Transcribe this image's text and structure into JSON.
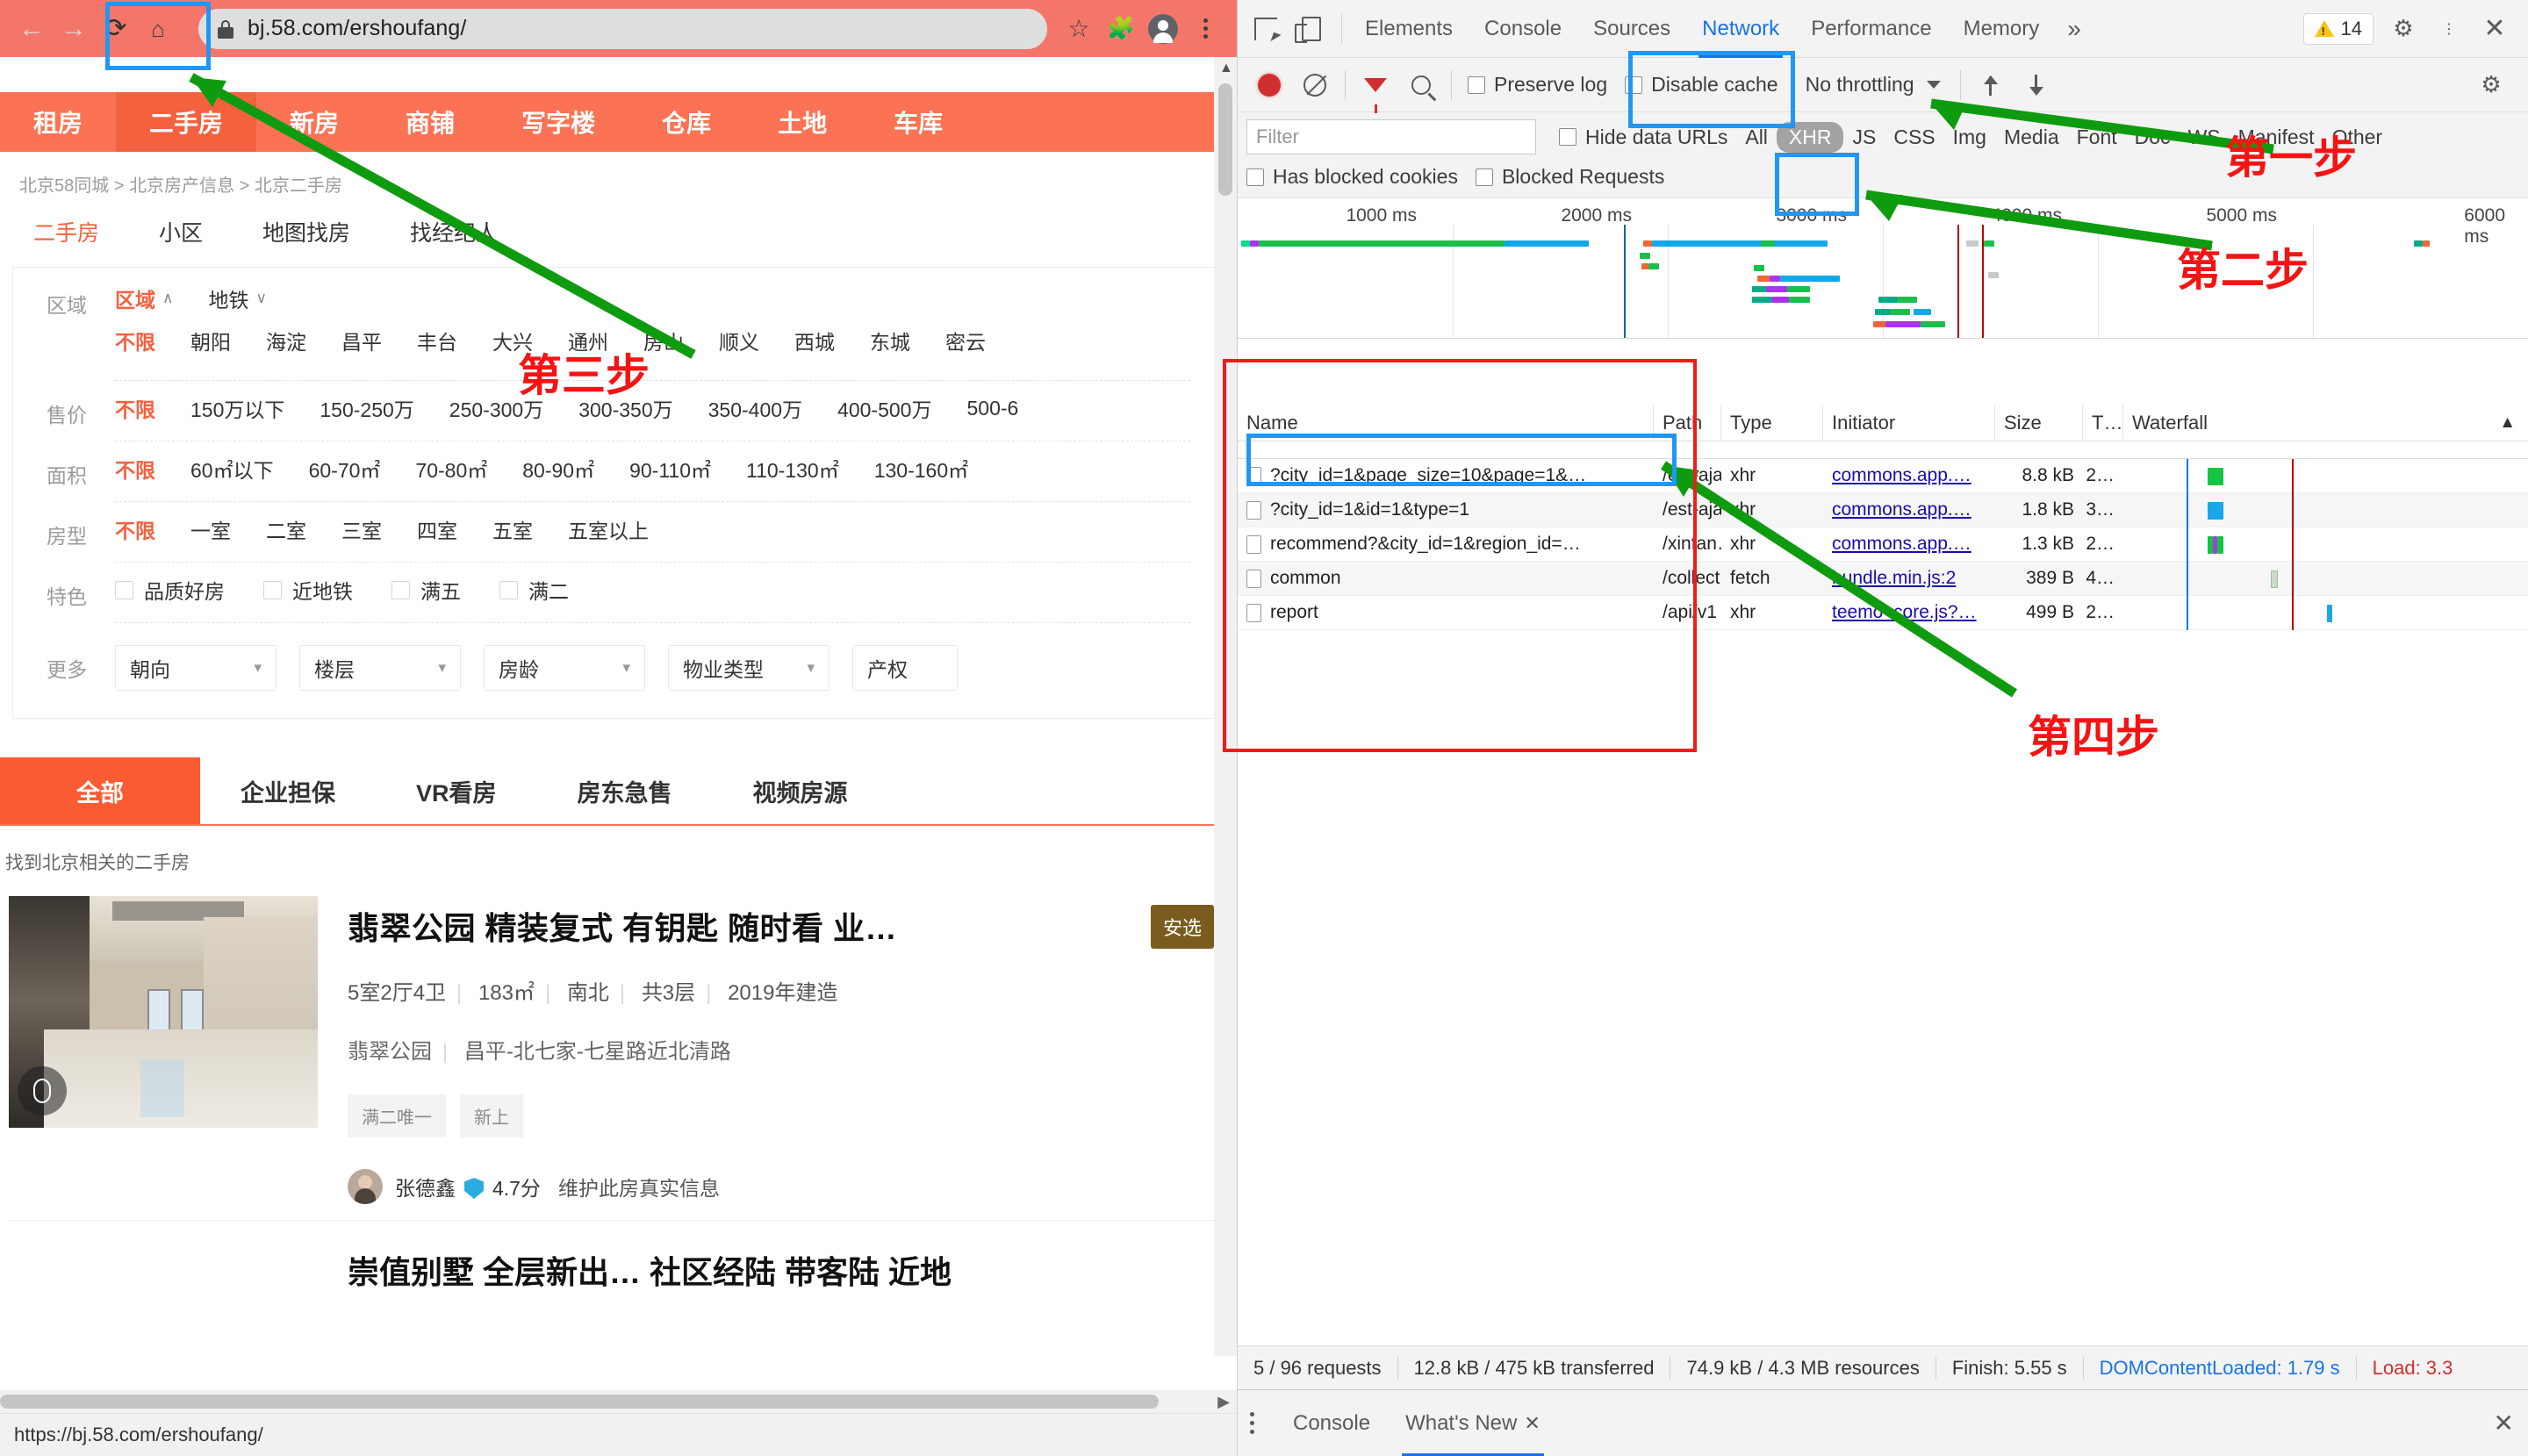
{
  "browser": {
    "url": "bj.58.com/ershoufang/",
    "status_url": "https://bj.58.com/ershoufang/",
    "icons": {
      "back": "←",
      "forward": "→",
      "reload": "⟳",
      "home": "⌂",
      "star": "☆",
      "puzzle": "🧩",
      "lock": "lock-icon"
    }
  },
  "site": {
    "nav": [
      {
        "label": "租房",
        "active": false
      },
      {
        "label": "二手房",
        "active": true
      },
      {
        "label": "新房",
        "active": false
      },
      {
        "label": "商铺",
        "active": false
      },
      {
        "label": "写字楼",
        "active": false
      },
      {
        "label": "仓库",
        "active": false
      },
      {
        "label": "土地",
        "active": false
      },
      {
        "label": "车库",
        "active": false
      }
    ],
    "breadcrumb": "北京58同城 > 北京房产信息 > 北京二手房",
    "subnav": [
      {
        "label": "二手房",
        "active": true
      },
      {
        "label": "小区",
        "active": false
      },
      {
        "label": "地图找房",
        "active": false
      },
      {
        "label": "找经纪人",
        "active": false
      }
    ],
    "filters": {
      "region": {
        "label": "区域",
        "toggles": [
          {
            "label": "区域",
            "selected": true,
            "caret": "∧"
          },
          {
            "label": "地铁",
            "selected": false,
            "caret": "∨"
          }
        ],
        "values": [
          "不限",
          "朝阳",
          "海淀",
          "昌平",
          "丰台",
          "大兴",
          "通州",
          "房山",
          "顺义",
          "西城",
          "东城",
          "密云"
        ],
        "selected": "不限"
      },
      "price": {
        "label": "售价",
        "values": [
          "不限",
          "150万以下",
          "150-250万",
          "250-300万",
          "300-350万",
          "350-400万",
          "400-500万",
          "500-6"
        ],
        "selected": "不限"
      },
      "area": {
        "label": "面积",
        "values": [
          "不限",
          "60㎡以下",
          "60-70㎡",
          "70-80㎡",
          "80-90㎡",
          "90-110㎡",
          "110-130㎡",
          "130-160㎡"
        ],
        "selected": "不限"
      },
      "rooms": {
        "label": "房型",
        "values": [
          "不限",
          "一室",
          "二室",
          "三室",
          "四室",
          "五室",
          "五室以上"
        ],
        "selected": "不限"
      },
      "features": {
        "label": "特色",
        "checkboxes": [
          "品质好房",
          "近地铁",
          "满五",
          "满二"
        ]
      },
      "more": {
        "label": "更多",
        "selects": [
          "朝向",
          "楼层",
          "房龄",
          "物业类型",
          "产权"
        ]
      }
    },
    "tabs": [
      {
        "label": "全部",
        "active": true
      },
      {
        "label": "企业担保",
        "active": false
      },
      {
        "label": "VR看房",
        "active": false
      },
      {
        "label": "房东急售",
        "active": false
      },
      {
        "label": "视频房源",
        "active": false
      }
    ],
    "found_text": "找到北京相关的二手房",
    "listing": {
      "title": "翡翠公园 精装复式 有钥匙 随时看 业…",
      "badge": "安选",
      "meta": [
        "5室2厅4卫",
        "183㎡",
        "南北",
        "共3层",
        "2019年建造"
      ],
      "address": [
        "翡翠公园",
        "昌平-北七家-七星路近北清路"
      ],
      "pills": [
        "满二唯一",
        "新上"
      ],
      "agent_name": "张德鑫",
      "agent_score": "4.7分",
      "agent_desc": "维护此房真实信息"
    },
    "listing2_title": "崇值别墅 全层新出… 社区经陆 带客陆 近地"
  },
  "devtools": {
    "tabs": [
      {
        "label": "Elements",
        "active": false
      },
      {
        "label": "Console",
        "active": false
      },
      {
        "label": "Sources",
        "active": false
      },
      {
        "label": "Network",
        "active": true
      },
      {
        "label": "Performance",
        "active": false
      },
      {
        "label": "Memory",
        "active": false
      }
    ],
    "more_tabs_icon": "»",
    "warning_count": "14",
    "icons": {
      "inspect": "inspect-icon",
      "device": "device-toolbar-icon",
      "gear": "⚙",
      "kebab": "⋮",
      "close": "✕",
      "record": "record-icon",
      "clear": "clear-icon",
      "filter": "funnel-icon",
      "search": "search-icon",
      "import": "import-har-icon",
      "export": "export-har-icon"
    },
    "toolbar": {
      "preserve_log": "Preserve log",
      "disable_cache": "Disable cache",
      "throttling": "No throttling"
    },
    "filterbar": {
      "filter_placeholder": "Filter",
      "hide_data_urls": "Hide data URLs",
      "has_blocked_cookies": "Has blocked cookies",
      "blocked_requests": "Blocked Requests",
      "resource_types": [
        "All",
        "XHR",
        "JS",
        "CSS",
        "Img",
        "Media",
        "Font",
        "Doc",
        "WS",
        "Manifest",
        "Other"
      ],
      "active_type": "XHR"
    },
    "timeline": {
      "ticks": [
        "1000 ms",
        "2000 ms",
        "3000 ms",
        "4000 ms",
        "5000 ms",
        "6000 ms"
      ]
    },
    "table": {
      "columns": [
        "Name",
        "Path",
        "Type",
        "Initiator",
        "Size",
        "T…",
        "Waterfall"
      ],
      "rows": [
        {
          "name": "?city_id=1&page_size=10&page=1&…",
          "path": "/est-aja…",
          "type": "xhr",
          "initiator": "commons.app.…",
          "size": "8.8 kB",
          "time": "2…"
        },
        {
          "name": "?city_id=1&id=1&type=1",
          "path": "/est-aja…",
          "type": "xhr",
          "initiator": "commons.app.…",
          "size": "1.8 kB",
          "time": "3…"
        },
        {
          "name": "recommend?&city_id=1&region_id=…",
          "path": "/xinfan…",
          "type": "xhr",
          "initiator": "commons.app.…",
          "size": "1.3 kB",
          "time": "2…"
        },
        {
          "name": "common",
          "path": "/collect…",
          "type": "fetch",
          "initiator": "bundle.min.js:2",
          "size": "389 B",
          "time": "4…"
        },
        {
          "name": "report",
          "path": "/api/v1",
          "type": "xhr",
          "initiator": "teemo_core.js?…",
          "size": "499 B",
          "time": "2…"
        }
      ]
    },
    "status": {
      "requests": "5 / 96 requests",
      "transferred": "12.8 kB / 475 kB transferred",
      "resources": "74.9 kB / 4.3 MB resources",
      "finish": "Finish: 5.55 s",
      "dcl": "DOMContentLoaded: 1.79 s",
      "load": "Load: 3.3"
    },
    "drawer": {
      "tabs": [
        {
          "label": "Console",
          "active": false
        },
        {
          "label": "What's New",
          "active": true
        }
      ],
      "close_icon": "✕"
    }
  },
  "annotations": {
    "step1": "第一步",
    "step2": "第二步",
    "step3": "第三步",
    "step4": "第四步"
  }
}
